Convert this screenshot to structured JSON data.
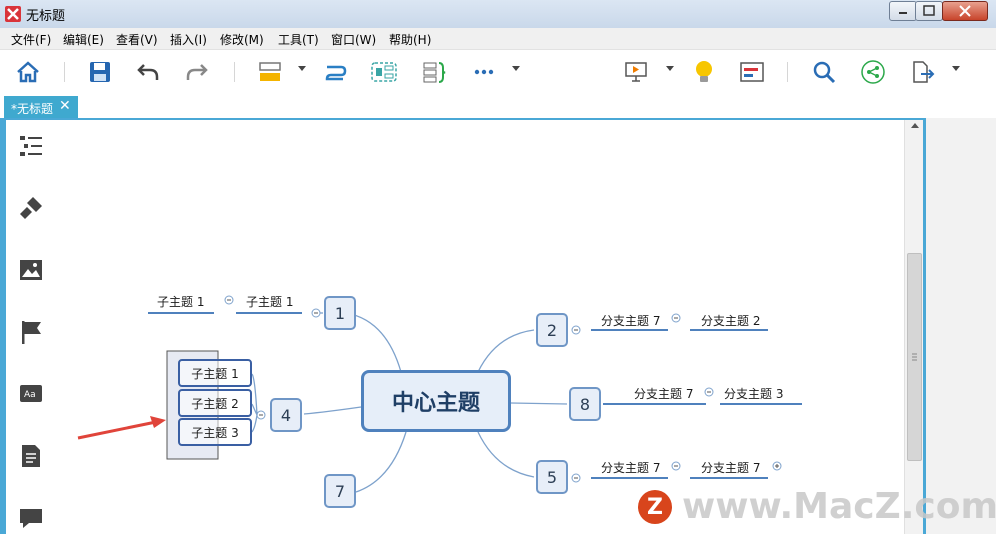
{
  "window": {
    "title": "无标题"
  },
  "menu": [
    "文件(F)",
    "编辑(E)",
    "查看(V)",
    "插入(I)",
    "修改(M)",
    "工具(T)",
    "窗口(W)",
    "帮助(H)"
  ],
  "toolbar_icons": [
    "home-icon",
    "save-icon",
    "undo-icon",
    "redo-icon",
    "topic-icon",
    "relationship-icon",
    "boundary-icon",
    "summary-icon",
    "more-icon",
    "presentation-icon",
    "lightbulb-icon",
    "gantt-icon",
    "search-icon",
    "share-icon",
    "export-icon"
  ],
  "tab": {
    "label": "*无标题",
    "close": "✕"
  },
  "right_panel_icons": [
    "outline-icon",
    "format-brush-icon",
    "image-icon",
    "marker-flag-icon",
    "font-icon",
    "notes-icon",
    "comment-icon"
  ],
  "mindmap": {
    "center": "中心主题",
    "nodes": [
      "1",
      "2",
      "8",
      "4",
      "7",
      "5"
    ],
    "labels": {
      "n1_a": "子主题 1",
      "n1_b": "子主题 1",
      "n2_a": "分支主题 7",
      "n2_b": "分支主题 2",
      "n8_a": "分支主题 7",
      "n8_b": "分支主题 3",
      "n5_a": "分支主题 7",
      "n5_b": "分支主题 7",
      "sel_1": "子主题 1",
      "sel_2": "子主题 2",
      "sel_3": "子主题 3"
    }
  },
  "watermark": {
    "logo": "Z",
    "text": "www.MacZ.com"
  },
  "colors": {
    "accent": "#3fa9cf",
    "topic_border": "#4f81bd",
    "arrow": "#e0443a"
  }
}
